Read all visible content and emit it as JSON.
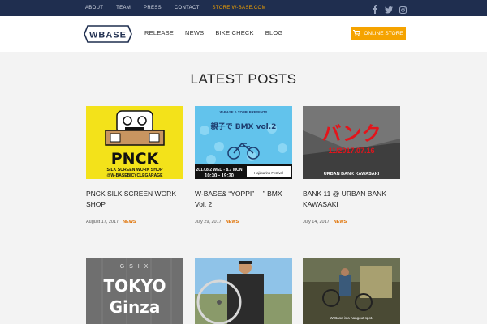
{
  "topbar": {
    "links": [
      "ABOUT",
      "TEAM",
      "PRESS",
      "CONTACT",
      "STORE.W-BASE.COM"
    ]
  },
  "header": {
    "logo_text": "WBASE",
    "nav": [
      "RELEASE",
      "NEWS",
      "BIKE CHECK",
      "BLOG"
    ],
    "store_button": "ONLINE STORE"
  },
  "section_title": "LATEST POSTS",
  "posts": [
    {
      "title": "PNCK SILK SCREEN WORK SHOP",
      "date": "August 17, 2017",
      "category": "NEWS",
      "image_text": {
        "big": "PNCK",
        "line1": "SILK SCREEN WORK SHOP",
        "line2": "@W-BASEBICYCLEGARAGE"
      }
    },
    {
      "title": "W-BASE& “YOPPI” 　” BMX Vol. 2",
      "date": "July 29, 2017",
      "category": "NEWS",
      "image_text": {
        "top": "W-BASE & YOPPI PRESENTS",
        "main": "親子で BMX vol.2",
        "date_line": "2017.8.2 WED - 8.7 MON",
        "time_line": "10:30 - 19:30",
        "venue": "Hajimarino Festival"
      }
    },
    {
      "title": "BANK 11 @ URBAN BANK KAWASAKI",
      "date": "July 14, 2017",
      "category": "NEWS",
      "image_text": {
        "big": "バンク",
        "date_line": "11/2017.07.16",
        "venue": "URBAN BANK KAWASAKI"
      }
    },
    {
      "image_text": {
        "top": "G S I X",
        "line1": "TOKYO",
        "line2": "Ginza"
      }
    },
    {
      "image_text": {}
    },
    {
      "image_text": {
        "caption": "W-Base is a hangout spot."
      }
    }
  ],
  "colors": {
    "topbar_bg": "#1f2e4f",
    "accent": "#f5a300",
    "category": "#e07000",
    "page_bg": "#f3f3f3"
  },
  "icons": [
    "facebook-icon",
    "twitter-icon",
    "instagram-icon",
    "cart-icon"
  ]
}
